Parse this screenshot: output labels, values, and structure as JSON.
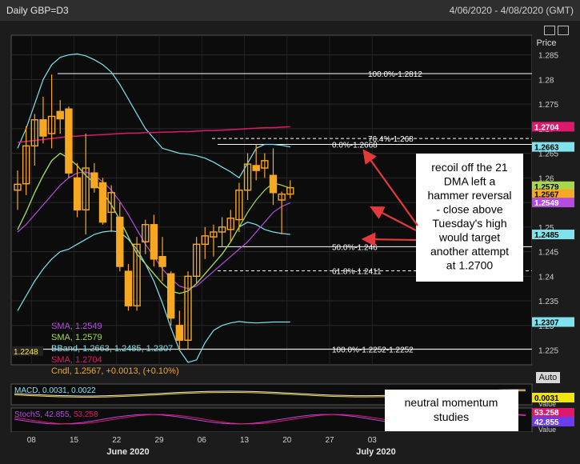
{
  "header": {
    "title": "Daily GBP=D3",
    "range": "4/06/2020 - 4/08/2020 (GMT)"
  },
  "price_label": "Price",
  "auto_label": "Auto",
  "colors": {
    "up": "#f7a823",
    "down": "#f7a823",
    "bband": "#7fe3ee",
    "sma200": "#e0186c",
    "sma21": "#a6d84a",
    "sma_purple": "#b64be0",
    "fib": "#ffffff",
    "bg": "#0c0c0c"
  },
  "chart_data": {
    "type": "candlestick",
    "ylim": [
      1.222,
      1.289
    ],
    "y_ticks": [
      "1.285",
      "1.28",
      "1.275",
      "1.27",
      "1.265",
      "1.26",
      "1.255",
      "1.25",
      "1.245",
      "1.24",
      "1.235",
      "1.23",
      "1.225"
    ],
    "x_ticks": [
      "08",
      "15",
      "22",
      "29",
      "06",
      "13",
      "20",
      "27",
      "03"
    ],
    "months": [
      "June 2020",
      "July 2020"
    ],
    "candles": [
      {
        "o": 1.2575,
        "h": 1.2615,
        "l": 1.2535,
        "c": 1.2587
      },
      {
        "o": 1.2588,
        "h": 1.2705,
        "l": 1.2565,
        "c": 1.2665
      },
      {
        "o": 1.2665,
        "h": 1.273,
        "l": 1.2625,
        "c": 1.2718
      },
      {
        "o": 1.2718,
        "h": 1.2765,
        "l": 1.267,
        "c": 1.2685
      },
      {
        "o": 1.269,
        "h": 1.281,
        "l": 1.266,
        "c": 1.2725
      },
      {
        "o": 1.2735,
        "h": 1.2758,
        "l": 1.269,
        "c": 1.272
      },
      {
        "o": 1.274,
        "h": 1.2745,
        "l": 1.26,
        "c": 1.261
      },
      {
        "o": 1.26,
        "h": 1.263,
        "l": 1.252,
        "c": 1.2535
      },
      {
        "o": 1.2535,
        "h": 1.269,
        "l": 1.2485,
        "c": 1.262
      },
      {
        "o": 1.261,
        "h": 1.263,
        "l": 1.257,
        "c": 1.258
      },
      {
        "o": 1.259,
        "h": 1.26,
        "l": 1.2505,
        "c": 1.251
      },
      {
        "o": 1.253,
        "h": 1.2585,
        "l": 1.249,
        "c": 1.257
      },
      {
        "o": 1.252,
        "h": 1.255,
        "l": 1.241,
        "c": 1.242
      },
      {
        "o": 1.241,
        "h": 1.2425,
        "l": 1.233,
        "c": 1.234
      },
      {
        "o": 1.234,
        "h": 1.248,
        "l": 1.233,
        "c": 1.2465
      },
      {
        "o": 1.247,
        "h": 1.2515,
        "l": 1.2445,
        "c": 1.2505
      },
      {
        "o": 1.2505,
        "h": 1.2525,
        "l": 1.242,
        "c": 1.2435
      },
      {
        "o": 1.244,
        "h": 1.248,
        "l": 1.239,
        "c": 1.242
      },
      {
        "o": 1.2405,
        "h": 1.241,
        "l": 1.23,
        "c": 1.2315
      },
      {
        "o": 1.23,
        "h": 1.233,
        "l": 1.225,
        "c": 1.227
      },
      {
        "o": 1.227,
        "h": 1.241,
        "l": 1.2252,
        "c": 1.24
      },
      {
        "o": 1.24,
        "h": 1.248,
        "l": 1.2385,
        "c": 1.2465
      },
      {
        "o": 1.2465,
        "h": 1.25,
        "l": 1.2435,
        "c": 1.2482
      },
      {
        "o": 1.248,
        "h": 1.2505,
        "l": 1.244,
        "c": 1.249
      },
      {
        "o": 1.249,
        "h": 1.252,
        "l": 1.246,
        "c": 1.25
      },
      {
        "o": 1.2495,
        "h": 1.2535,
        "l": 1.247,
        "c": 1.2518
      },
      {
        "o": 1.2515,
        "h": 1.259,
        "l": 1.249,
        "c": 1.2575
      },
      {
        "o": 1.2575,
        "h": 1.265,
        "l": 1.2555,
        "c": 1.2628
      },
      {
        "o": 1.2625,
        "h": 1.2668,
        "l": 1.2595,
        "c": 1.2615
      },
      {
        "o": 1.262,
        "h": 1.265,
        "l": 1.26,
        "c": 1.2635
      },
      {
        "o": 1.2605,
        "h": 1.266,
        "l": 1.2545,
        "c": 1.257
      },
      {
        "o": 1.2555,
        "h": 1.2572,
        "l": 1.2485,
        "c": 1.2567
      },
      {
        "o": 1.2567,
        "h": 1.2595,
        "l": 1.2558,
        "c": 1.258
      }
    ],
    "sma200": [
      1.2672,
      1.2674,
      1.2676,
      1.2678,
      1.268,
      1.2682,
      1.2684,
      1.2685,
      1.2686,
      1.2687,
      1.2688,
      1.2689,
      1.269,
      1.2691,
      1.2691,
      1.2692,
      1.2692,
      1.2693,
      1.2693,
      1.2694,
      1.2694,
      1.2695,
      1.2696,
      1.2696,
      1.2697,
      1.2698,
      1.2699,
      1.27,
      1.2701,
      1.2702,
      1.2702,
      1.2703,
      1.2704
    ],
    "sma21": [
      1.2495,
      1.253,
      1.257,
      1.2605,
      1.2635,
      1.265,
      1.264,
      1.2625,
      1.2605,
      1.259,
      1.257,
      1.2545,
      1.2515,
      1.248,
      1.2445,
      1.2425,
      1.2405,
      1.2385,
      1.237,
      1.2365,
      1.237,
      1.2385,
      1.2405,
      1.2425,
      1.2445,
      1.247,
      1.25,
      1.253,
      1.2555,
      1.2575,
      1.259,
      1.2585,
      1.2579
    ],
    "sma_purple": [
      1.249,
      1.2505,
      1.2525,
      1.2545,
      1.2565,
      1.2585,
      1.26,
      1.261,
      1.2612,
      1.2605,
      1.2592,
      1.2575,
      1.2552,
      1.2525,
      1.2495,
      1.2465,
      1.244,
      1.2415,
      1.2395,
      1.238,
      1.2375,
      1.238,
      1.2395,
      1.241,
      1.2425,
      1.244,
      1.2455,
      1.247,
      1.249,
      1.251,
      1.253,
      1.2542,
      1.2549
    ],
    "bband_upper": [
      1.266,
      1.27,
      1.275,
      1.28,
      1.283,
      1.2845,
      1.285,
      1.2852,
      1.2848,
      1.284,
      1.283,
      1.2815,
      1.279,
      1.276,
      1.273,
      1.27,
      1.268,
      1.266,
      1.2655,
      1.265,
      1.2648,
      1.2645,
      1.264,
      1.2632,
      1.2622,
      1.2612,
      1.26,
      1.263,
      1.266,
      1.2668,
      1.2668,
      1.2666,
      1.2663
    ],
    "bband_lower": [
      1.233,
      1.236,
      1.239,
      1.2415,
      1.2435,
      1.245,
      1.2455,
      1.2465,
      1.2475,
      1.2485,
      1.249,
      1.2492,
      1.249,
      1.2475,
      1.2455,
      1.2425,
      1.239,
      1.2345,
      1.2295,
      1.225,
      1.2225,
      1.223,
      1.2265,
      1.229,
      1.23,
      1.2305,
      1.2308,
      1.2306,
      1.2305,
      1.2306,
      1.2307,
      1.2307,
      1.2307
    ],
    "bband_mid": [
      1.2495,
      1.253,
      1.257,
      1.2605,
      1.2635,
      1.265,
      1.264,
      1.2625,
      1.2605,
      1.259,
      1.257,
      1.2545,
      1.2515,
      1.248,
      1.2445,
      1.2425,
      1.2405,
      1.2385,
      1.237,
      1.2365,
      1.237,
      1.2385,
      1.2405,
      1.2425,
      1.2445,
      1.247,
      1.25,
      1.251,
      1.2505,
      1.2495,
      1.249,
      1.2487,
      1.2485
    ],
    "fib_levels": [
      {
        "label": "100.0%-1.2812",
        "value": 1.2812,
        "dash": false
      },
      {
        "label": "76.4%-1.268",
        "value": 1.268,
        "dash": true
      },
      {
        "label": "0.0%-1.2668",
        "value": 1.2668,
        "dash": false
      },
      {
        "label": "50.0%-1.246",
        "value": 1.246,
        "dash": false
      },
      {
        "label": "61.8%-1.2411",
        "value": 1.2411,
        "dash": true
      },
      {
        "label": "100.0%-1.2252-1.2252",
        "value": 1.2252,
        "dash": false
      }
    ],
    "right_badges": [
      {
        "text": "1.2704",
        "value": 1.2704,
        "bg": "#e0186c",
        "fg": "#ffffff"
      },
      {
        "text": "1.2663",
        "value": 1.2663,
        "bg": "#7fe3ee",
        "fg": "#000000"
      },
      {
        "text": "1.2579",
        "value": 1.2583,
        "bg": "#a6d84a",
        "fg": "#000000"
      },
      {
        "text": "1.2567",
        "value": 1.2567,
        "bg": "#f7a823",
        "fg": "#000000"
      },
      {
        "text": "1.2549",
        "value": 1.255,
        "bg": "#b64be0",
        "fg": "#ffffff"
      },
      {
        "text": "1.2485",
        "value": 1.2485,
        "bg": "#7fe3ee",
        "fg": "#000000"
      },
      {
        "text": "1.2307",
        "value": 1.2307,
        "bg": "#7fe3ee",
        "fg": "#000000"
      }
    ],
    "left_badge": {
      "text": "1.2248",
      "value": 1.2248
    },
    "legend": [
      {
        "text": "SMA, 1.2549",
        "color": "#b64be0"
      },
      {
        "text": "SMA, 1.2579",
        "color": "#a6d84a"
      },
      {
        "text": "BBand, 1.2663, 1.2485, 1.2307",
        "color": "#7fe3ee"
      },
      {
        "text": "SMA, 1.2704",
        "color": "#e0186c"
      },
      {
        "text": "Cndl, 1.2567, +0.0013, (+0.10%)",
        "color": "#f7a823"
      }
    ],
    "annotation": "recoil off the 21 DMA left a hammer reversal - close above Tuesday's high would target another attempt at 1.2700",
    "annotation_lines": [
      "recoil off the 21",
      "DMA left a",
      "hammer reversal",
      "- close above",
      "Tuesday's high",
      "would target",
      "another attempt",
      "at 1.2700"
    ],
    "macd": {
      "label": "MACD, 0.0031, 0.0022",
      "badge": "0.0031",
      "badge2": "Value"
    },
    "stoch": {
      "label_prefix": "StochS, ",
      "v1": "42.855",
      "v2": "53.258",
      "badge1": "53.258",
      "badge2": "42.855",
      "badge3": "Value"
    },
    "momentum_note_lines": [
      "neutral momentum",
      "studies"
    ]
  }
}
